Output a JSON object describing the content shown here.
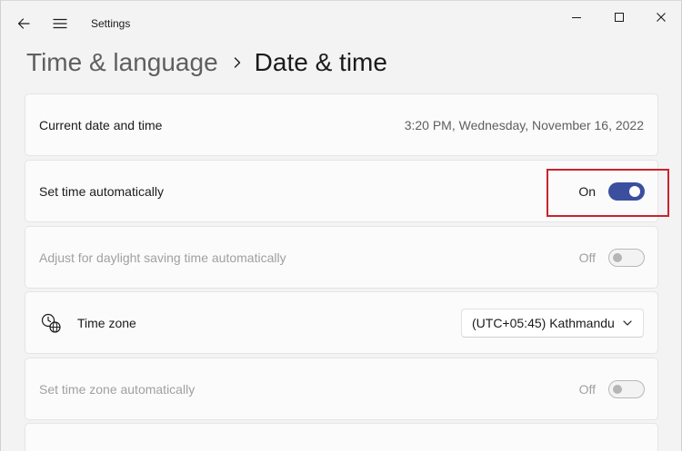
{
  "app": {
    "title": "Settings"
  },
  "breadcrumb": {
    "parent": "Time & language",
    "current": "Date & time"
  },
  "rows": {
    "current_datetime": {
      "label": "Current date and time",
      "value": "3:20 PM, Wednesday, November 16, 2022"
    },
    "set_time_auto": {
      "label": "Set time automatically",
      "state": "On"
    },
    "daylight_saving": {
      "label": "Adjust for daylight saving time automatically",
      "state": "Off"
    },
    "time_zone": {
      "label": "Time zone",
      "selected": "(UTC+05:45) Kathmandu"
    },
    "set_tz_auto": {
      "label": "Set time zone automatically",
      "state": "Off"
    }
  },
  "icons": {
    "back": "back-arrow-icon",
    "menu": "hamburger-menu-icon",
    "minimize": "minimize-icon",
    "maximize": "maximize-icon",
    "close": "close-icon",
    "breadcrumb_separator": "chevron-right-icon",
    "time_zone": "clock-globe-icon",
    "dropdown": "chevron-down-icon"
  },
  "colors": {
    "accent": "#3b4f9e",
    "highlight": "#c9232d",
    "background": "#f3f3f3",
    "card": "#fbfbfb"
  }
}
